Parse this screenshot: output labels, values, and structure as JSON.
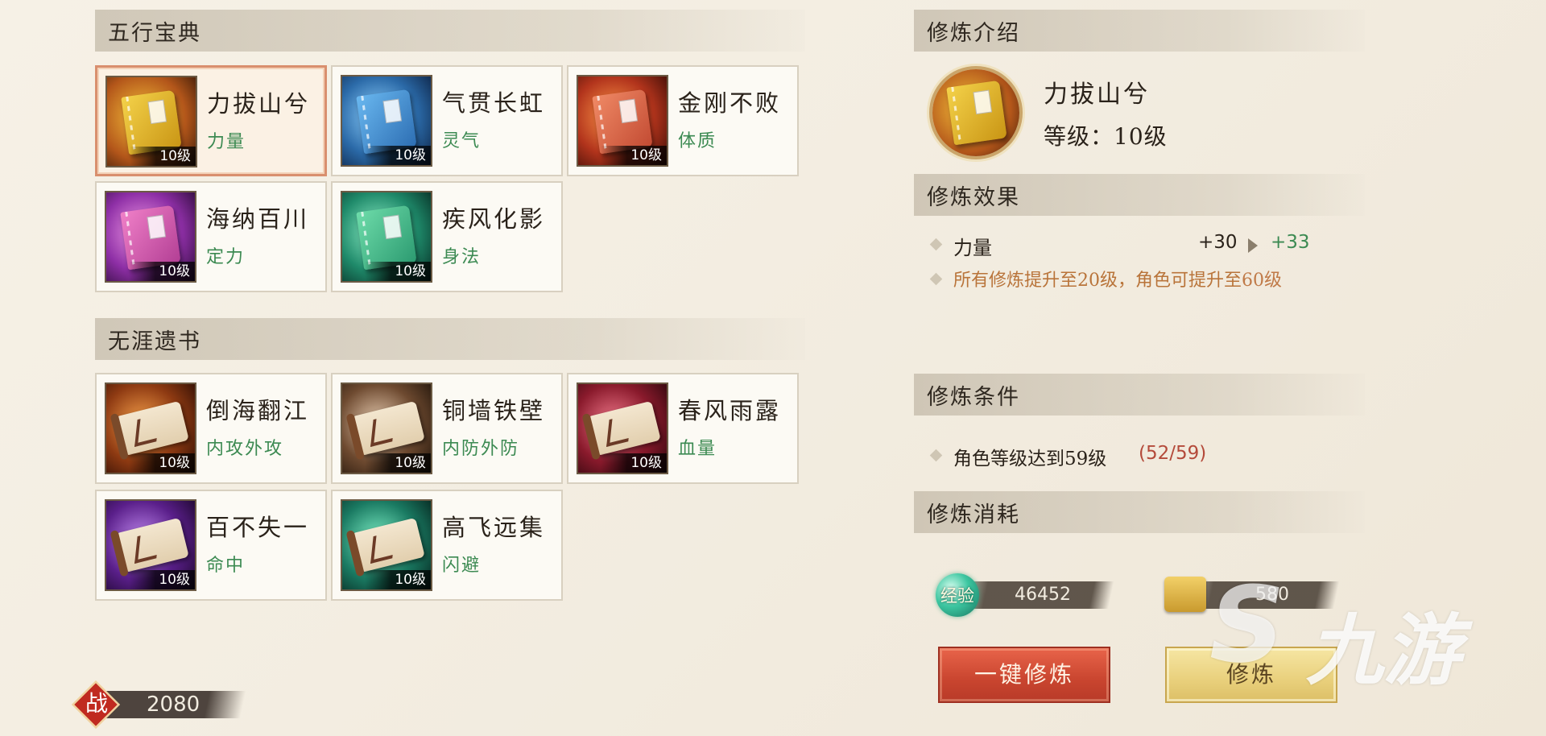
{
  "sections": {
    "wuxing": "五行宝典",
    "wuya": "无涯遗书"
  },
  "wuxing_items": [
    {
      "name": "力拔山兮",
      "attr": "力量",
      "level": "10级",
      "color": "#e3b021",
      "icon": "yellow-book-icon"
    },
    {
      "name": "气贯长虹",
      "attr": "灵气",
      "level": "10级",
      "color": "#3f86c8",
      "icon": "blue-book-icon"
    },
    {
      "name": "金刚不败",
      "attr": "体质",
      "level": "10级",
      "color": "#d85a3c",
      "icon": "red-book-icon"
    },
    {
      "name": "海纳百川",
      "attr": "定力",
      "level": "10级",
      "color": "#c653b6",
      "icon": "purple-book-icon"
    },
    {
      "name": "疾风化影",
      "attr": "身法",
      "level": "10级",
      "color": "#3fa67c",
      "icon": "green-book-icon"
    }
  ],
  "wuya_items": [
    {
      "name": "倒海翻江",
      "attr": "内攻外攻",
      "level": "10级",
      "color": "#c15a22",
      "icon": "orange-scroll-icon"
    },
    {
      "name": "铜墙铁壁",
      "attr": "内防外防",
      "level": "10级",
      "color": "#8a6a4c",
      "icon": "bronze-scroll-icon"
    },
    {
      "name": "春风雨露",
      "attr": "血量",
      "level": "10级",
      "color": "#b52c44",
      "icon": "crimson-scroll-icon"
    },
    {
      "name": "百不失一",
      "attr": "命中",
      "level": "10级",
      "color": "#7a3aa8",
      "icon": "purple-scroll-icon"
    },
    {
      "name": "高飞远集",
      "attr": "闪避",
      "level": "10级",
      "color": "#2f8c74",
      "icon": "teal-scroll-icon"
    }
  ],
  "detail": {
    "intro_header": "修炼介绍",
    "skill_name": "力拔山兮",
    "level_text": "等级：10级",
    "effect_header": "修炼效果",
    "effect_stat": "力量",
    "effect_from": "+30",
    "effect_to": "+33",
    "effect_note_prefix": "所有修炼提升至20级，角色可提升至",
    "effect_note_value": "60级",
    "condition_header": "修炼条件",
    "condition_text": "角色等级达到59级",
    "condition_progress": "(52/59)",
    "cost_header": "修炼消耗",
    "exp_label": "经验",
    "exp_value": "46452",
    "scroll_value": "580"
  },
  "buttons": {
    "auto_train": "一键修炼",
    "train": "修炼"
  },
  "power": {
    "label": "战",
    "value": "2080"
  },
  "watermark": "九游",
  "colors": {
    "attr_green": "#3c8a52",
    "note_orange": "#b9743a",
    "progress_red": "#b44a3a",
    "selected_border": "#d98f6e"
  }
}
